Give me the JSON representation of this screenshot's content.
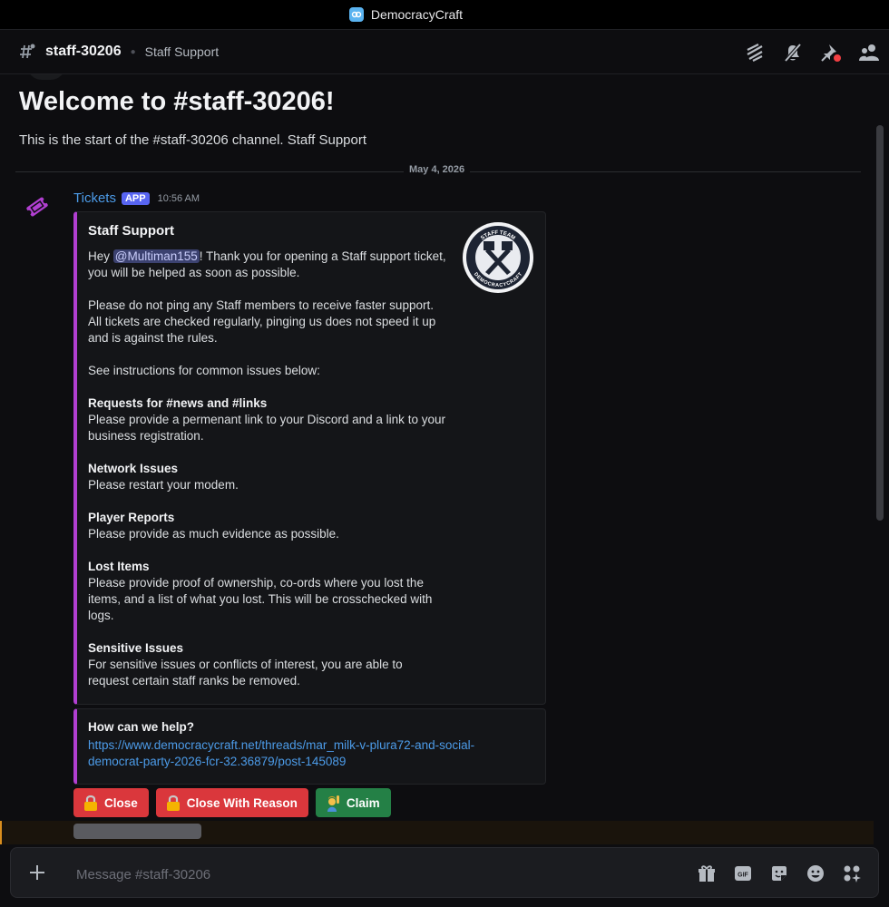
{
  "window": {
    "title": "DemocracyCraft"
  },
  "header": {
    "channel_name": "staff-30206",
    "topic": "Staff Support"
  },
  "welcome": {
    "title": "Welcome to #staff-30206!",
    "subtitle": "This is the start of the #staff-30206 channel. Staff Support"
  },
  "divider_date": "May 4, 2026",
  "message": {
    "author": "Tickets",
    "badge": "APP",
    "timestamp": "10:56 AM",
    "embed": {
      "title": "Staff Support",
      "greeting_prefix": "Hey ",
      "mention": "@Multiman155",
      "greeting_suffix": "! Thank you for opening a Staff support ticket, you will be helped as soon as possible.",
      "para2": "Please do not ping any Staff members to receive faster support. All tickets are checked regularly, pinging us does not speed it up and is against the rules.",
      "para3": "See instructions for common issues below:",
      "sections": [
        {
          "heading": "Requests for #news and #links",
          "text": "Please provide a permenant link to your Discord and a link to your business registration."
        },
        {
          "heading": "Network Issues",
          "text": "Please restart your modem."
        },
        {
          "heading": "Player Reports",
          "text": "Please provide as much evidence as possible."
        },
        {
          "heading": "Lost Items",
          "text": "Please provide proof of ownership, co-ords where you lost the items, and a list of what you lost. This will be crosschecked with logs."
        },
        {
          "heading": "Sensitive Issues",
          "text": "For sensitive issues or conflicts of interest, you are able to request certain staff ranks be removed."
        }
      ],
      "thumbnail_top_text": "STAFF TEAM",
      "thumbnail_bottom_text": "DEMOCRACYCRAFT"
    },
    "embed2": {
      "title": "How can we help?",
      "link": "https://www.democracycraft.net/threads/mar_milk-v-plura72-and-social-democrat-party-2026-fcr-32.36879/post-145089"
    },
    "buttons": {
      "close": "Close",
      "close_reason": "Close With Reason",
      "claim": "Claim"
    }
  },
  "composer": {
    "placeholder": "Message #staff-30206"
  },
  "colors": {
    "accent": "#5865f2",
    "embed_bar": "#b13fd1",
    "danger": "#da373c",
    "success": "#248046",
    "link": "#4c9be8"
  }
}
